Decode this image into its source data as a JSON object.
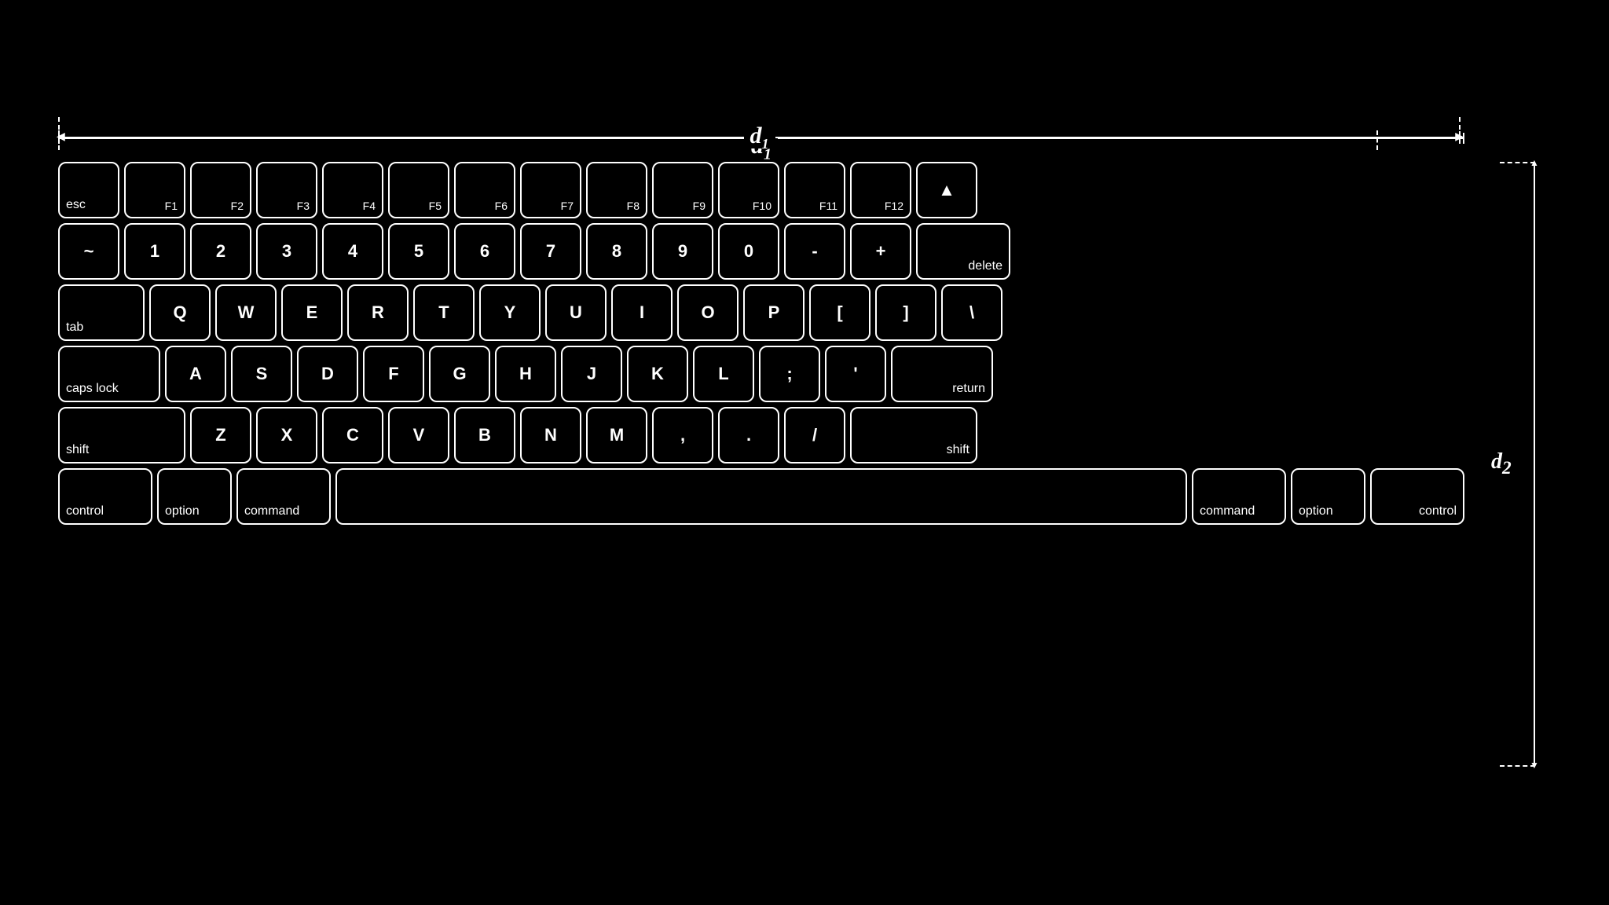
{
  "diagram": {
    "dim1_label": "d",
    "dim1_sub": "1",
    "dim2_label": "d",
    "dim2_sub": "2"
  },
  "keyboard": {
    "row1": [
      {
        "key": "esc",
        "label": "esc",
        "type": "bottom-left"
      },
      {
        "key": "f1",
        "label": "F1",
        "type": "bottom-right"
      },
      {
        "key": "f2",
        "label": "F2",
        "type": "bottom-right"
      },
      {
        "key": "f3",
        "label": "F3",
        "type": "bottom-right"
      },
      {
        "key": "f4",
        "label": "F4",
        "type": "bottom-right"
      },
      {
        "key": "f5",
        "label": "F5",
        "type": "bottom-right"
      },
      {
        "key": "f6",
        "label": "F6",
        "type": "bottom-right"
      },
      {
        "key": "f7",
        "label": "F7",
        "type": "bottom-right"
      },
      {
        "key": "f8",
        "label": "F8",
        "type": "bottom-right"
      },
      {
        "key": "f9",
        "label": "F9",
        "type": "bottom-right"
      },
      {
        "key": "f10",
        "label": "F10",
        "type": "bottom-right"
      },
      {
        "key": "f11",
        "label": "F11",
        "type": "bottom-right"
      },
      {
        "key": "f12",
        "label": "F12",
        "type": "bottom-right"
      },
      {
        "key": "eject",
        "label": "⏏",
        "type": "center"
      }
    ],
    "row2": [
      {
        "key": "tilde",
        "label": "~"
      },
      {
        "key": "1",
        "label": "1"
      },
      {
        "key": "2",
        "label": "2"
      },
      {
        "key": "3",
        "label": "3"
      },
      {
        "key": "4",
        "label": "4"
      },
      {
        "key": "5",
        "label": "5"
      },
      {
        "key": "6",
        "label": "6"
      },
      {
        "key": "7",
        "label": "7"
      },
      {
        "key": "8",
        "label": "8"
      },
      {
        "key": "9",
        "label": "9"
      },
      {
        "key": "0",
        "label": "0"
      },
      {
        "key": "minus",
        "label": "-"
      },
      {
        "key": "plus",
        "label": "+"
      },
      {
        "key": "delete",
        "label": "delete",
        "type": "bottom-right"
      }
    ],
    "row3": [
      {
        "key": "tab",
        "label": "tab"
      },
      {
        "key": "q",
        "label": "Q"
      },
      {
        "key": "w",
        "label": "W"
      },
      {
        "key": "e",
        "label": "E"
      },
      {
        "key": "r",
        "label": "R"
      },
      {
        "key": "t",
        "label": "T"
      },
      {
        "key": "y",
        "label": "Y"
      },
      {
        "key": "u",
        "label": "U"
      },
      {
        "key": "i",
        "label": "I"
      },
      {
        "key": "o",
        "label": "O"
      },
      {
        "key": "p",
        "label": "P"
      },
      {
        "key": "lbracket",
        "label": "["
      },
      {
        "key": "rbracket",
        "label": "]"
      },
      {
        "key": "backslash",
        "label": "\\"
      }
    ],
    "row4": [
      {
        "key": "capslock",
        "label": "caps lock"
      },
      {
        "key": "a",
        "label": "A"
      },
      {
        "key": "s",
        "label": "S"
      },
      {
        "key": "d",
        "label": "D"
      },
      {
        "key": "f",
        "label": "F"
      },
      {
        "key": "g",
        "label": "G"
      },
      {
        "key": "h",
        "label": "H"
      },
      {
        "key": "j",
        "label": "J"
      },
      {
        "key": "k",
        "label": "K"
      },
      {
        "key": "l",
        "label": "L"
      },
      {
        "key": "semicolon",
        "label": ";"
      },
      {
        "key": "quote",
        "label": "'"
      },
      {
        "key": "return",
        "label": "return",
        "type": "bottom-right"
      }
    ],
    "row5": [
      {
        "key": "shift-l",
        "label": "shift"
      },
      {
        "key": "z",
        "label": "Z"
      },
      {
        "key": "x",
        "label": "X"
      },
      {
        "key": "c",
        "label": "C"
      },
      {
        "key": "v",
        "label": "V"
      },
      {
        "key": "b",
        "label": "B"
      },
      {
        "key": "n",
        "label": "N"
      },
      {
        "key": "m",
        "label": "M"
      },
      {
        "key": "comma",
        "label": ","
      },
      {
        "key": "period",
        "label": "."
      },
      {
        "key": "slash",
        "label": "/"
      },
      {
        "key": "shift-r",
        "label": "shift",
        "type": "bottom-right"
      }
    ],
    "row6": [
      {
        "key": "control-l",
        "label": "control"
      },
      {
        "key": "option-l",
        "label": "option"
      },
      {
        "key": "command-l",
        "label": "command"
      },
      {
        "key": "space",
        "label": ""
      },
      {
        "key": "command-r",
        "label": "command"
      },
      {
        "key": "option-r",
        "label": "option"
      },
      {
        "key": "control-r",
        "label": "control",
        "type": "bottom-right"
      }
    ]
  }
}
